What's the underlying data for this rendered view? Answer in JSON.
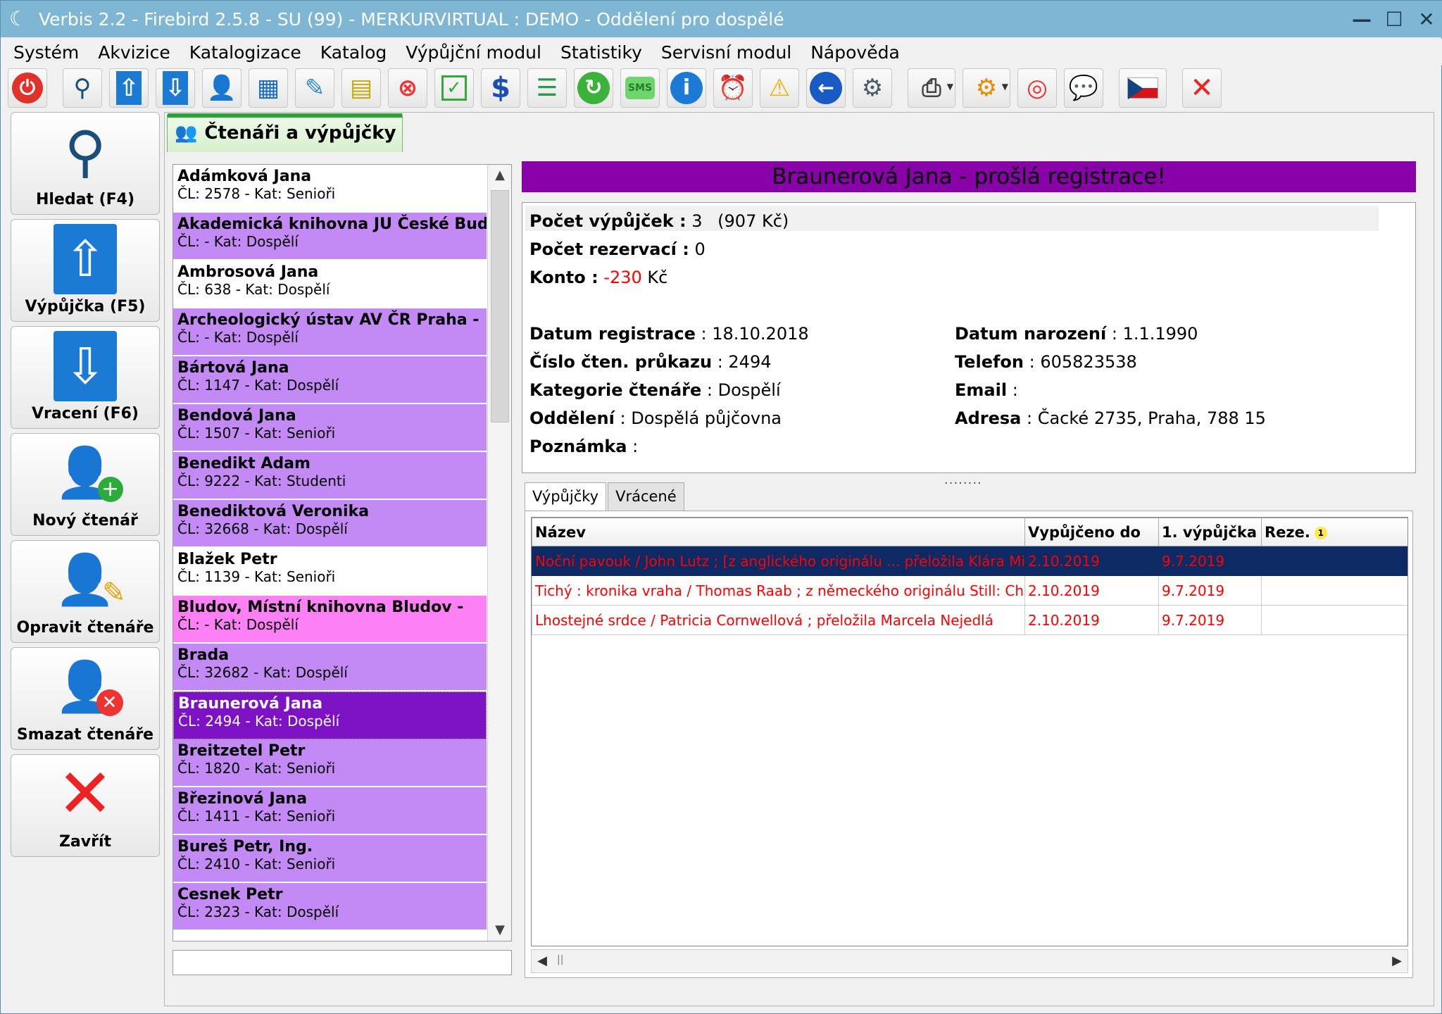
{
  "window": {
    "title": "Verbis 2.2 - Firebird 2.5.8 - SU (99) - MERKURVIRTUAL : DEMO - Oddělení pro dospělé"
  },
  "menu": [
    "Systém",
    "Akvizice",
    "Katalogizace",
    "Katalog",
    "Výpůjční modul",
    "Statistiky",
    "Servisní modul",
    "Nápověda"
  ],
  "sidebar": [
    {
      "label": "Hledat (F4)",
      "icon": "magnifier-icon"
    },
    {
      "label": "Výpůjčka (F5)",
      "icon": "arrow-up-icon"
    },
    {
      "label": "Vracení (F6)",
      "icon": "arrow-down-icon"
    },
    {
      "label": "Nový čtenář",
      "icon": "add-user-icon"
    },
    {
      "label": "Opravit čtenáře",
      "icon": "edit-user-icon"
    },
    {
      "label": "Smazat čtenáře",
      "icon": "delete-user-icon"
    },
    {
      "label": "Zavřít",
      "icon": "close-x-icon"
    }
  ],
  "main_tab": "Čtenáři a výpůjčky",
  "readers": [
    {
      "name": "Adámková Jana",
      "detail": "ČL: 2578 - Kat: Senioři",
      "style": "white"
    },
    {
      "name": "Akademická knihovna JU České Bud...",
      "detail": "ČL:  - Kat: Dospělí",
      "style": "purple"
    },
    {
      "name": "Ambrosová Jana",
      "detail": "ČL: 638 - Kat: Dospělí",
      "style": "white"
    },
    {
      "name": "Archeologický ústav AV ČR Praha -",
      "detail": "ČL:  - Kat: Dospělí",
      "style": "purple"
    },
    {
      "name": "Bártová Jana",
      "detail": "ČL: 1147 - Kat: Dospělí",
      "style": "purple"
    },
    {
      "name": "Bendová Jana",
      "detail": "ČL: 1507 - Kat: Senioři",
      "style": "purple"
    },
    {
      "name": "Benedikt Adam",
      "detail": "ČL: 9222 - Kat: Studenti",
      "style": "purple"
    },
    {
      "name": "Benediktová Veronika",
      "detail": "ČL: 32668 - Kat: Dospělí",
      "style": "purple"
    },
    {
      "name": "Blažek Petr",
      "detail": "ČL: 1139 - Kat: Senioři",
      "style": "white"
    },
    {
      "name": "Bludov, Místní knihovna Bludov -",
      "detail": "ČL:  - Kat: Dospělí",
      "style": "pink"
    },
    {
      "name": "Brada",
      "detail": "ČL: 32682 - Kat: Dospělí",
      "style": "purple"
    },
    {
      "name": "Braunerová Jana",
      "detail": "ČL: 2494 - Kat: Dospělí",
      "style": "selected"
    },
    {
      "name": "Breitzetel Petr",
      "detail": "ČL: 1820 - Kat: Senioři",
      "style": "purple"
    },
    {
      "name": "Březinová Jana",
      "detail": "ČL: 1411 - Kat: Senioři",
      "style": "purple"
    },
    {
      "name": "Bureš Petr, Ing.",
      "detail": "ČL: 2410 - Kat: Senioři",
      "style": "purple"
    },
    {
      "name": "Cesnek Petr",
      "detail": "ČL: 2323 - Kat: Dospělí",
      "style": "purple"
    }
  ],
  "reader": {
    "header": "Braunerová Jana - prošlá registrace!",
    "loans_label": "Počet výpůjček :",
    "loans_value": "3",
    "loans_price": "(907 Kč)",
    "reservations_label": "Počet rezervací :",
    "reservations_value": "0",
    "account_label": "Konto :",
    "account_value": "-230",
    "account_currency": "Kč",
    "reg_date_label": "Datum registrace",
    "reg_date": ": 18.10.2018",
    "card_label": "Číslo čten. průkazu",
    "card": ": 2494",
    "category_label": "Kategorie čtenáře",
    "category": ": Dospělí",
    "department_label": "Oddělení",
    "department": ": Dospělá půjčovna",
    "note_label": "Poznámka",
    "note": ":",
    "birth_label": "Datum narození",
    "birth": ": 1.1.1990",
    "phone_label": "Telefon",
    "phone": ": 605823538",
    "email_label": "Email",
    "email": ":",
    "address_label": "Adresa",
    "address": ": Čacké 2735, Praha, 788 15"
  },
  "subtabs": [
    "Výpůjčky",
    "Vrácené"
  ],
  "loans_table": {
    "columns": [
      "Název",
      "Vypůjčeno do",
      "1. výpůjčka",
      "Reze."
    ],
    "badge": "1",
    "rows": [
      [
        "Noční pavouk / John Lutz ; [z anglického originálu ... přeložila Klára Mičk",
        "2.10.2019",
        "9.7.2019",
        ""
      ],
      [
        "Tichý : kronika vraha / Thomas Raab ; z německého originálu Still: Chror",
        "2.10.2019",
        "9.7.2019",
        ""
      ],
      [
        "Lhostejné srdce / Patricia Cornwellová ; přeložila Marcela Nejedlá",
        "2.10.2019",
        "9.7.2019",
        ""
      ]
    ]
  },
  "colors": {
    "header_bg": "#8800a8",
    "row_purple": "#c38af6",
    "row_pink": "#fd80f5",
    "row_selected": "#7d11c4",
    "loan_text": "#ff0000",
    "title_bar": "#7eb6d3"
  }
}
